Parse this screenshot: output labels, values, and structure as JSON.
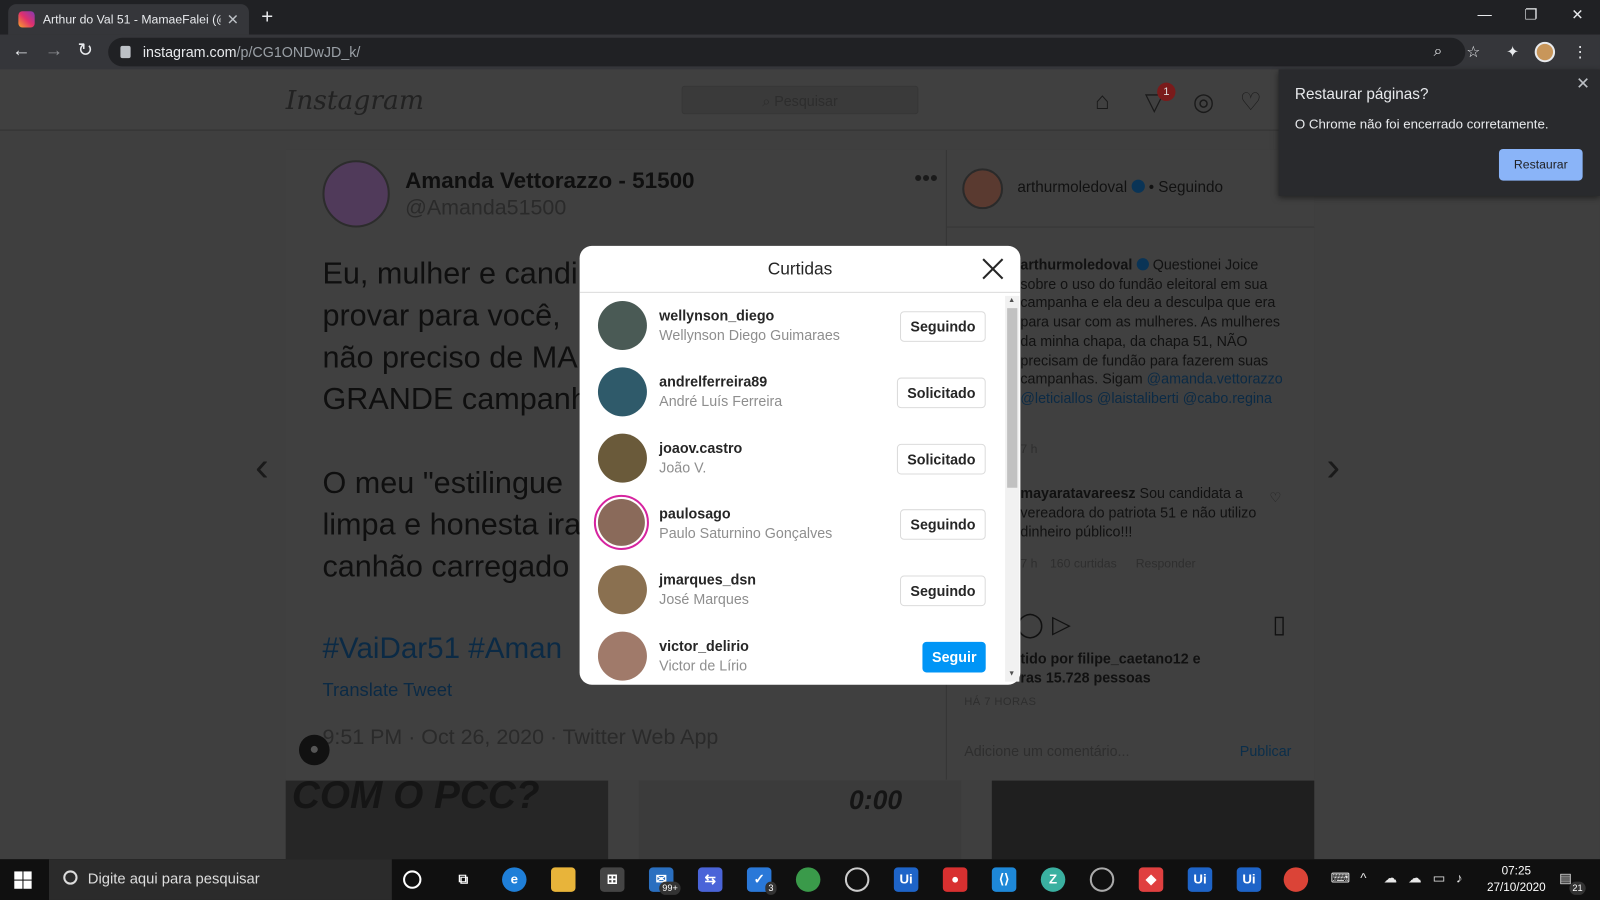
{
  "browser": {
    "tab_title": "Arthur do Val 51 - MamaeFalei (@",
    "url_host": "instagram.com",
    "url_path": "/p/CG1ONDwJD_k/"
  },
  "instagram": {
    "logo": "Instagram",
    "search_placeholder": "Pesquisar",
    "notif_count": "1"
  },
  "tweet": {
    "name": "Amanda Vettorazzo - 51500",
    "handle": "@Amanda51500",
    "lines_p1": [
      "Eu, mulher e candi",
      "provar para você,",
      "não preciso de MA",
      "GRANDE campanh"
    ],
    "lines_p2": [
      "O meu \"estilingue",
      "limpa e honesta ira",
      "canhão carregado"
    ],
    "tags": "#VaiDar51 #Aman",
    "translate": "Translate Tweet",
    "time": "9:51 PM · Oct 26, 2020 · Twitter Web App"
  },
  "post_side": {
    "username": "arthurmoledoval",
    "following": "• Seguindo",
    "caption_user": "arthurmoledoval",
    "caption_text": "Questionei Joice sobre o uso do fundão eleitoral em sua campanha e ela deu a desculpa que era para usar com as mulheres. As mulheres da minha chapa, da chapa 51, NÃO precisam de fundão para fazerem suas campanhas. Sigam",
    "caption_links": "@amanda.vettorazzo @leticiallos @laistaliberti @cabo.regina",
    "caption_age": "7 h",
    "comment_user": "mayaratavareesz",
    "comment_text": "Sou candidata a vereadora do patriota 51 e não utilizo dinheiro público!!!",
    "comment_age": "7 h",
    "comment_likes": "160 curtidas",
    "comment_reply": "Responder",
    "likes_line1": "tido por filipe_caetano12 e",
    "likes_line2": "ras 15.728 pessoas",
    "posted_ago": "HÁ 7 HORAS",
    "add_comment": "Adicione um comentário...",
    "publish": "Publicar"
  },
  "likes_modal": {
    "title": "Curtidas",
    "users": [
      {
        "username": "wellynson_diego",
        "full_name": "Wellynson Diego Guimaraes",
        "button": "Seguindo",
        "avatar_color": "#4a5a55"
      },
      {
        "username": "andrelferreira89",
        "full_name": "André Luís Ferreira",
        "button": "Solicitado",
        "avatar_color": "#2f5a6a"
      },
      {
        "username": "joaov.castro",
        "full_name": "João V.",
        "button": "Solicitado",
        "avatar_color": "#6a5a3a"
      },
      {
        "username": "paulosago",
        "full_name": "Paulo Saturnino Gonçalves",
        "button": "Seguindo",
        "avatar_color": "#8a6a5a"
      },
      {
        "username": "jmarques_dsn",
        "full_name": "José Marques",
        "button": "Seguindo",
        "avatar_color": "#8a7050"
      },
      {
        "username": "victor_delirio",
        "full_name": "Victor de Lírio",
        "button": "Seguir",
        "avatar_color": "#a07a6a"
      }
    ]
  },
  "restore": {
    "title": "Restaurar páginas?",
    "message": "O Chrome não foi encerrado corretamente.",
    "button": "Restaurar"
  },
  "taskbar": {
    "search_placeholder": "Digite aqui para pesquisar",
    "mail_badge": "99+",
    "todo_badge": "3",
    "time": "07:25",
    "date": "27/10/2020",
    "notif_count": "21"
  },
  "thumbs": {
    "left_text": "COM O PCC?",
    "mid_text": "0:00"
  },
  "colors": {
    "follow_blue": "#0095f6",
    "story_ring": "#d6249f",
    "restore_button": "#8ab4f8"
  }
}
